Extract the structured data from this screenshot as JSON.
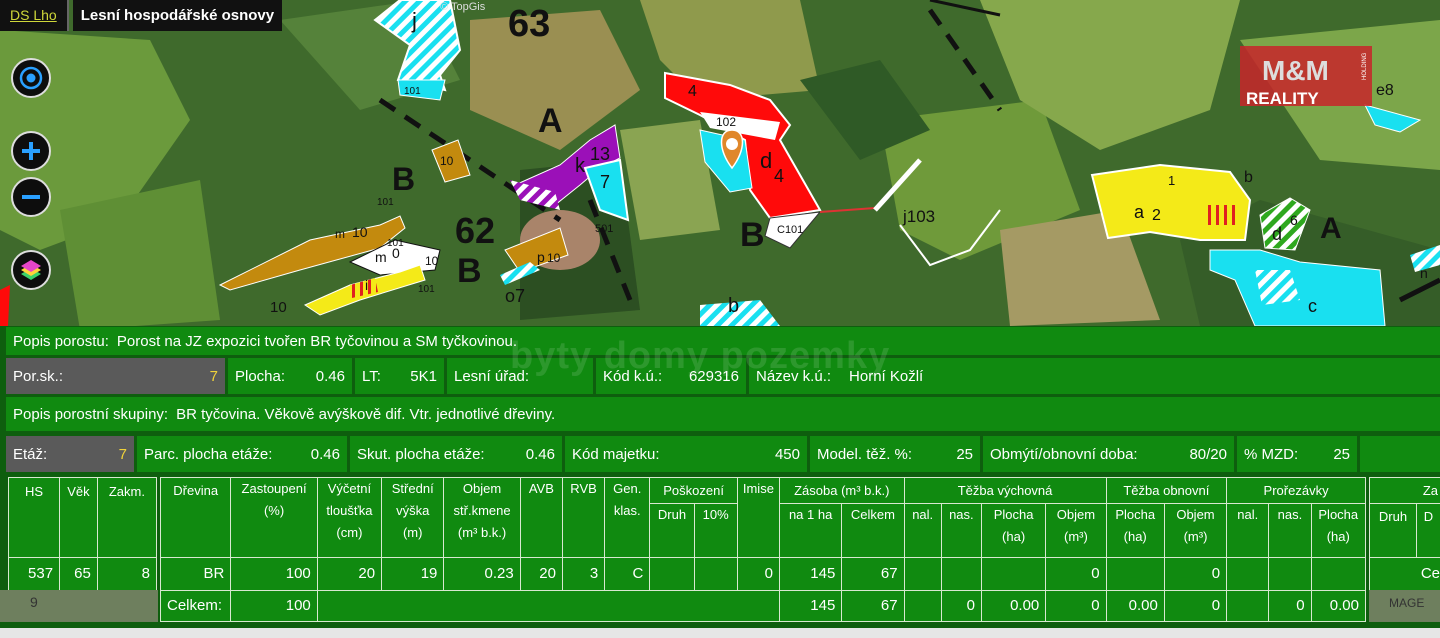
{
  "topbar": {
    "ds_link": "DS Lho",
    "title": "Lesní hospodářské osnovy"
  },
  "map": {
    "copyright": "© TopGis",
    "labels": {
      "n63": "63",
      "n62": "62",
      "A1": "A",
      "A2": "A",
      "B1": "B",
      "B2": "B",
      "B3": "B",
      "k13": "13",
      "k": "k",
      "s7": "7",
      "n501": "501",
      "n101a": "101",
      "n101b": "101",
      "n101c": "101",
      "n101d": "101",
      "j": "j",
      "n4a": "4",
      "n102": "102",
      "d": "d",
      "n4b": "4",
      "c101": "C101",
      "j103": "j103",
      "n10a": "10",
      "m10": "m",
      "n10b": "10",
      "n10c": "10",
      "m0": "m",
      "n0": "0",
      "i": "i",
      "n10d": "10",
      "p": "p",
      "n10e": "10",
      "o7": "o7",
      "b8": "b",
      "a2a": "a",
      "a2b": "2",
      "n1": "1",
      "b": "b",
      "d6": "d",
      "n6": "6",
      "c": "c",
      "e8": "e8",
      "n": "n",
      "n10f": "10"
    }
  },
  "logo": {
    "top": "M&M",
    "bottom": "REALITY",
    "side": "HOLDING"
  },
  "watermark": "byty domy pozemky",
  "controls": {
    "locate": "locate-icon",
    "zoom_in": "+",
    "zoom_out": "−",
    "layers": "layers-icon"
  },
  "info": {
    "popis_porostu_label": "Popis porostu:",
    "popis_porostu": "Porost na JZ expozici tvořen BR tyčovinou a SM tyčkovinou.",
    "por_sk_label": "Por.sk.:",
    "por_sk": "7",
    "plocha_label": "Plocha:",
    "plocha": "0.46",
    "lt_label": "LT:",
    "lt": "5K1",
    "lesni_urad_label": "Lesní úřad:",
    "lesni_urad": "",
    "kod_ku_label": "Kód k.ú.:",
    "kod_ku": "629316",
    "nazev_ku_label": "Název k.ú.:",
    "nazev_ku": "Horní Kožlí",
    "popis_skupiny_label": "Popis porostní skupiny:",
    "popis_skupiny": "BR tyčovina. Věkově avýškově dif. Vtr. jednotlivé dřeviny.",
    "etaz_label": "Etáž:",
    "etaz": "7",
    "parc_plocha_label": "Parc. plocha etáže:",
    "parc_plocha": "0.46",
    "skut_plocha_label": "Skut. plocha etáže:",
    "skut_plocha": "0.46",
    "kod_majetku_label": "Kód majetku:",
    "kod_majetku": "450",
    "model_tez_label": "Model. těž. %:",
    "model_tez": "25",
    "obmyti_label": "Obmýtí/obnovní doba:",
    "obmyti": "80/20",
    "mzd_label": "% MZD:",
    "mzd": "25"
  },
  "left_table": {
    "headers": [
      "HS",
      "Věk",
      "Zakm."
    ],
    "row": [
      "537",
      "65",
      "8"
    ]
  },
  "main_table": {
    "h": {
      "drevina": "Dřevina",
      "zast": "Zastoupení",
      "zast2": "(%)",
      "vyc": "Výčetní",
      "vyc2": "tloušťka",
      "vyc3": "(cm)",
      "str": "Střední",
      "str2": "výška",
      "str3": "(m)",
      "obj": "Objem",
      "obj2": "stř.kmene",
      "obj3": "(m³ b.k.)",
      "avb": "AVB",
      "rvb": "RVB",
      "gen": "Gen.",
      "gen2": "klas.",
      "pos": "Poškození",
      "druh": "Druh",
      "p10": "10%",
      "imise": "Imise",
      "zas": "Zásoba (m³ b.k.)",
      "na1ha": "na 1 ha",
      "celkem": "Celkem",
      "tv": "Těžba výchovná",
      "nal": "nal.",
      "nas": "nas.",
      "plocha": "Plocha",
      "ha": "(ha)",
      "objem": "Objem",
      "m3": "(m³)",
      "to": "Těžba obnovní",
      "pro": "Prořezávky"
    },
    "row": {
      "drevina": "BR",
      "zast": "100",
      "vyc": "20",
      "str": "19",
      "obj": "0.23",
      "avb": "20",
      "rvb": "3",
      "gen": "C",
      "druh": "",
      "p10": "",
      "imise": "0",
      "na1ha": "145",
      "celkem": "67",
      "tv_nal": "",
      "tv_nas": "",
      "tv_plocha": "",
      "tv_objem": "0",
      "to_plocha": "",
      "to_objem": "0",
      "pr_nal": "",
      "pr_nas": "",
      "pr_plocha": ""
    },
    "total": {
      "label": "Celkem:",
      "zast": "100",
      "na1ha": "145",
      "celkem": "67",
      "tv_nal": "",
      "tv_nas": "0",
      "tv_plocha": "0.00",
      "tv_objem": "0",
      "to_plocha": "0.00",
      "to_objem": "0",
      "pr_nal": "",
      "pr_nas": "0",
      "pr_plocha": "0.00"
    }
  },
  "right_table": {
    "h_top": "Za",
    "druh": "Druh",
    "d": "D",
    "row": "Ce"
  },
  "bottom": {
    "left": "9",
    "right": "MAGE"
  }
}
